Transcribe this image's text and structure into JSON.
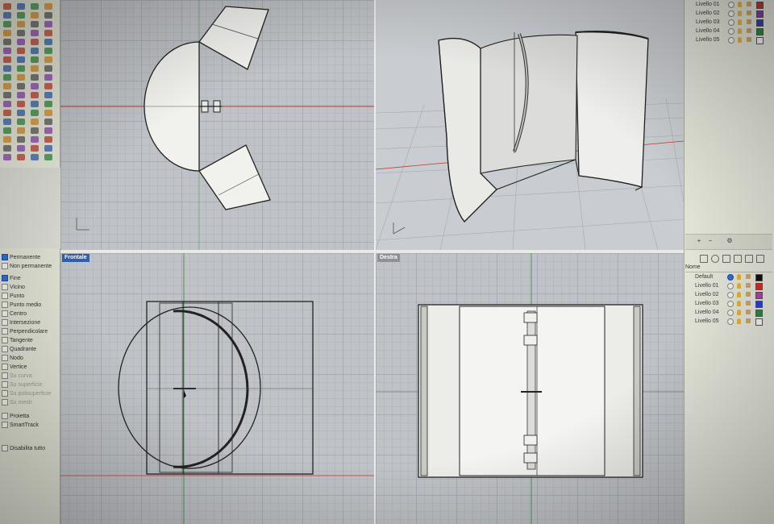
{
  "viewports": {
    "front_label": "Frontale",
    "right_label": "Destra"
  },
  "osnap": {
    "items": [
      {
        "label": "Permanente",
        "checked": true,
        "enabled": true
      },
      {
        "label": "Non permanente",
        "checked": false,
        "enabled": true
      },
      {
        "label": "Fine",
        "checked": true,
        "enabled": true
      },
      {
        "label": "Vicino",
        "checked": false,
        "enabled": true
      },
      {
        "label": "Punto",
        "checked": false,
        "enabled": true
      },
      {
        "label": "Punto medio",
        "checked": false,
        "enabled": true
      },
      {
        "label": "Centro",
        "checked": false,
        "enabled": true
      },
      {
        "label": "Intersezione",
        "checked": false,
        "enabled": true
      },
      {
        "label": "Perpendicolare",
        "checked": false,
        "enabled": true
      },
      {
        "label": "Tangente",
        "checked": false,
        "enabled": true
      },
      {
        "label": "Quadrante",
        "checked": false,
        "enabled": true
      },
      {
        "label": "Nodo",
        "checked": false,
        "enabled": true
      },
      {
        "label": "Vertice",
        "checked": false,
        "enabled": true
      },
      {
        "label": "Su curva",
        "checked": false,
        "enabled": false
      },
      {
        "label": "Su superficie",
        "checked": false,
        "enabled": false
      },
      {
        "label": "Su polisuperficie",
        "checked": false,
        "enabled": false
      },
      {
        "label": "Su mesh",
        "checked": false,
        "enabled": false
      },
      {
        "label": "Proietta",
        "checked": false,
        "enabled": true
      },
      {
        "label": "SmartTrack",
        "checked": false,
        "enabled": true
      },
      {
        "label": "Disabilita tutto",
        "checked": false,
        "enabled": true
      }
    ]
  },
  "layers_top": [
    {
      "name": "Livello 01",
      "color": "#d32b2b"
    },
    {
      "name": "Livello 02",
      "color": "#7a3fb0"
    },
    {
      "name": "Livello 03",
      "color": "#2b3fd3"
    },
    {
      "name": "Livello 04",
      "color": "#2b8a3a"
    },
    {
      "name": "Livello 05",
      "color": "#f2f2f2"
    }
  ],
  "layer_panel": {
    "add_label": "+",
    "remove_label": "−",
    "filter_label": "⚙",
    "column_header": "Nome",
    "layers": [
      {
        "name": "Default",
        "color": "#111111",
        "current": true
      },
      {
        "name": "Livello 01",
        "color": "#d32b2b",
        "current": false
      },
      {
        "name": "Livello 02",
        "color": "#b03fb0",
        "current": false
      },
      {
        "name": "Livello 03",
        "color": "#2b3fd3",
        "current": false
      },
      {
        "name": "Livello 04",
        "color": "#2b8a3a",
        "current": false
      },
      {
        "name": "Livello 05",
        "color": "#f2f2f2",
        "current": false
      }
    ]
  },
  "toolbar_icons": [
    "select-points-icon",
    "rectangle-icon",
    "transform-icon",
    "polyline-icon",
    "circle-icon",
    "arc-icon",
    "curve-icon",
    "fillet-icon",
    "surface-icon",
    "extrude-icon",
    "solid-icon",
    "boolean-icon",
    "mesh-icon",
    "dimension-icon",
    "render-icon",
    "analyze-icon",
    "layer-icon",
    "grid-icon"
  ]
}
